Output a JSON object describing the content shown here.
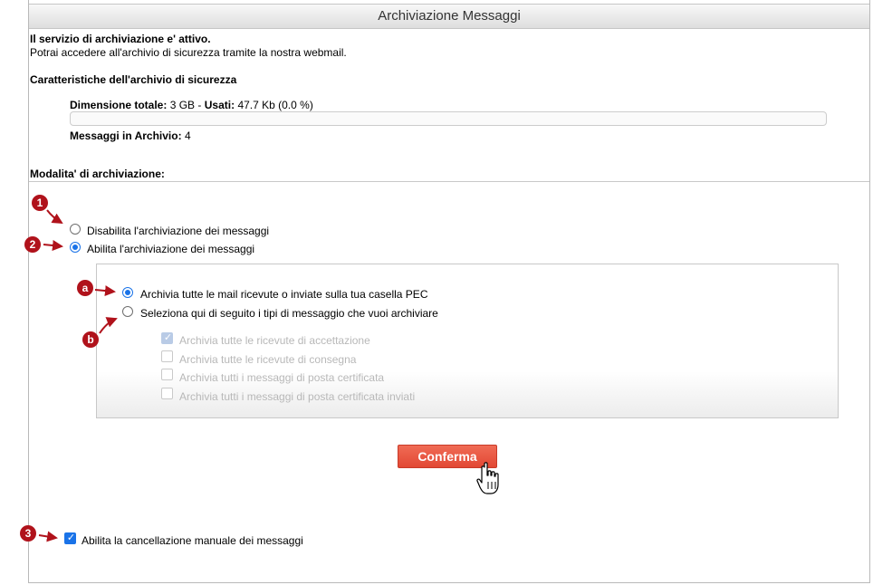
{
  "header": {
    "title": "Archiviazione Messaggi"
  },
  "status": {
    "active": "Il servizio di archiviazione e' attivo.",
    "info": "Potrai accedere all'archivio di sicurezza tramite la nostra webmail."
  },
  "archive": {
    "heading": "Caratteristiche dell'archivio di sicurezza",
    "size_label": "Dimensione totale:",
    "size_value": "3 GB",
    "sep": "-",
    "used_label": "Usati:",
    "used_value": "47.7 Kb (0.0 %)",
    "usage_fraction": 0.0,
    "messages_label": "Messaggi in Archivio:",
    "messages_value": "4"
  },
  "mode": {
    "heading": "Modalita' di archiviazione:",
    "disable_label": "Disabilita l'archiviazione dei messaggi",
    "enable_label": "Abilita l'archiviazione dei messaggi",
    "selected": "enable",
    "sub": {
      "all_label": "Archivia tutte le mail ricevute o inviate sulla tua casella PEC",
      "select_label": "Seleziona qui di seguito i tipi di messaggio che vuoi archiviare",
      "selected": "all",
      "options": [
        {
          "label": "Archivia tutte le ricevute di accettazione",
          "checked": true
        },
        {
          "label": "Archivia tutte le ricevute di consegna",
          "checked": false
        },
        {
          "label": "Archivia tutti i messaggi di posta certificata",
          "checked": false
        },
        {
          "label": "Archivia tutti i messaggi di posta certificata inviati",
          "checked": false
        }
      ]
    }
  },
  "confirm_label": "Conferma",
  "manual_delete": {
    "label": "Abilita la cancellazione manuale dei messaggi",
    "checked": true
  },
  "annotations": {
    "m1": "1",
    "m2": "2",
    "m3": "3",
    "ma": "a",
    "mb": "b"
  },
  "colors": {
    "accent": "#1a73e8",
    "button": "#e24834",
    "marker": "#b0121b"
  },
  "icons": {
    "cursor": "hand-pointer-icon",
    "checkmark": "check-icon"
  }
}
